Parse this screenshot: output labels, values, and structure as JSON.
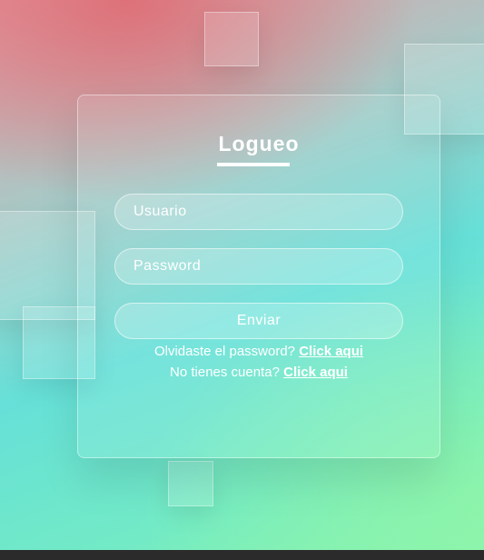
{
  "login": {
    "title": "Logueo",
    "username_placeholder": "Usuario",
    "password_placeholder": "Password",
    "submit_label": "Enviar",
    "forgot_text": "Olvidaste el password?",
    "forgot_link": "Click aqui",
    "signup_text": "No tienes cuenta?",
    "signup_link": "Click aqui"
  },
  "colors": {
    "top_left": "#e59ca3",
    "middle": "#66e0d8",
    "bottom_right": "#8ff5ac",
    "text": "#ffffff"
  }
}
